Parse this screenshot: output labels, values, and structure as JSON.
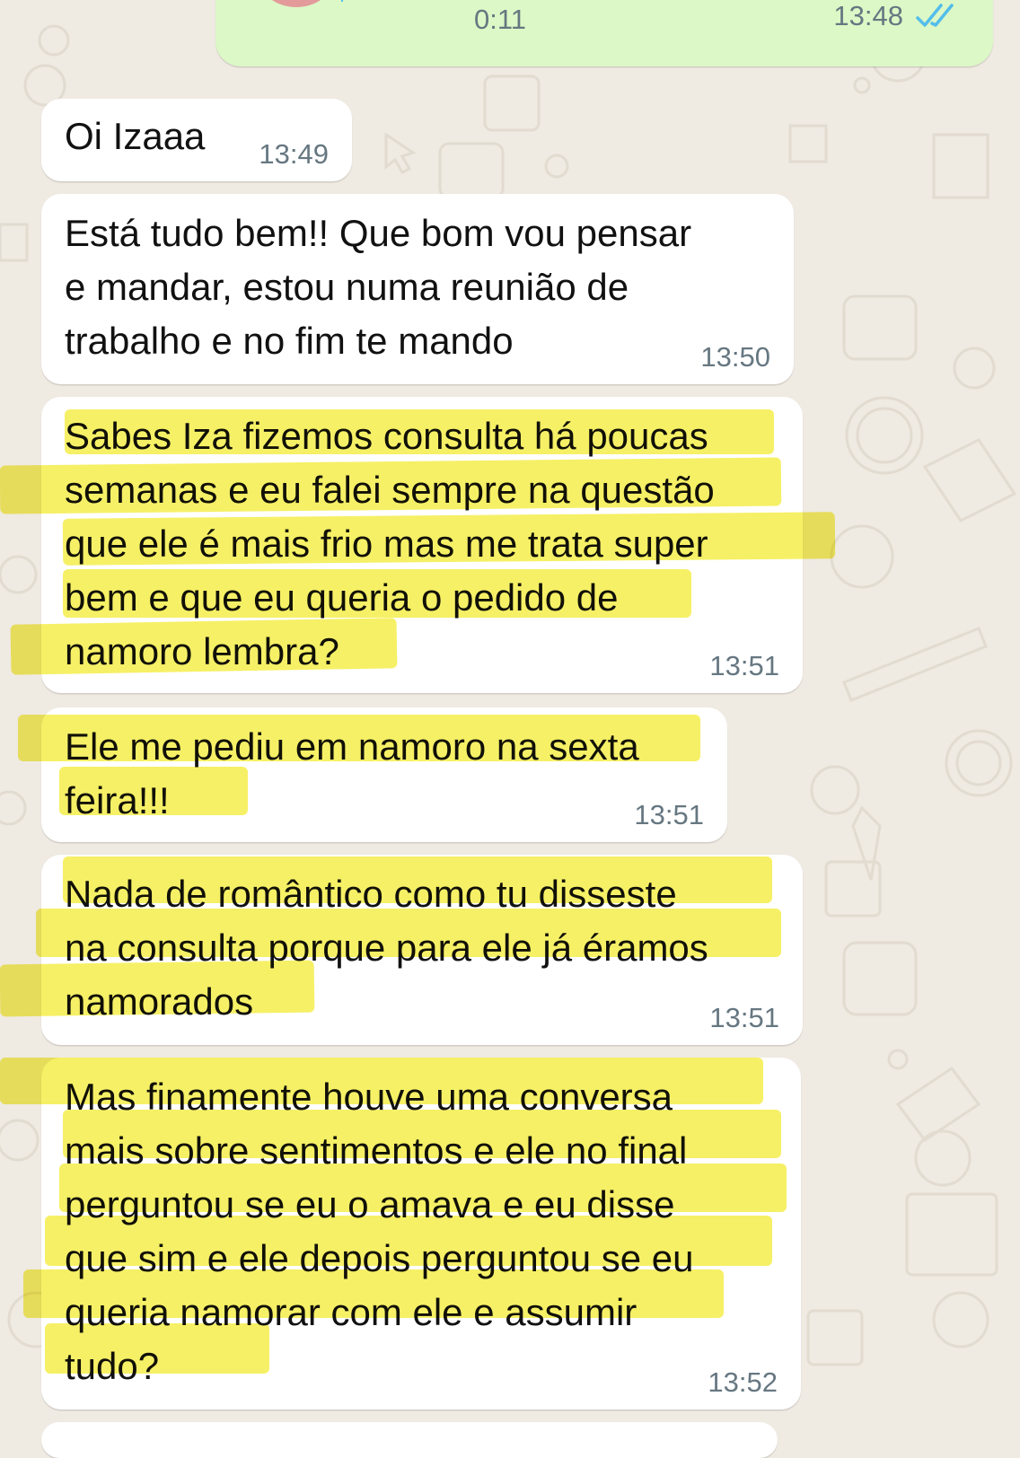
{
  "colors": {
    "chat_background": "#efeae2",
    "incoming_bubble": "#ffffff",
    "outgoing_bubble": "#dcf8c6",
    "timestamp": "#667781",
    "read_ticks": "#53bdeb",
    "highlighter": "#f4ec3a"
  },
  "outgoing_voice": {
    "duration": "0:11",
    "time": "13:48",
    "status_icon": "double-check-read-icon"
  },
  "messages": [
    {
      "text": "Oi Izaaa",
      "time": "13:49",
      "highlighted": false
    },
    {
      "text": "Está tudo bem!! Que bom vou pensar\ne mandar, estou numa reunião de\ntrabalho e no fim te mando",
      "time": "13:50",
      "highlighted": false
    },
    {
      "text": "Sabes Iza fizemos consulta há poucas\nsemanas e eu falei sempre na questão\nque ele é mais frio mas me trata super\nbem e que eu queria o pedido de\nnamoro lembra?",
      "time": "13:51",
      "highlighted": true
    },
    {
      "text": "Ele me pediu em namoro na sexta\nfeira!!!",
      "time": "13:51",
      "highlighted": true
    },
    {
      "text": "Nada de romântico como tu disseste\nna consulta porque para ele já éramos\nnamorados",
      "time": "13:51",
      "highlighted": true
    },
    {
      "text": "Mas finamente houve uma conversa\nmais sobre sentimentos e ele no final\nperguntou se eu o amava e eu disse\nque sim e ele depois perguntou se eu\nqueria namorar com ele e assumir\ntudo?",
      "time": "13:52",
      "highlighted": true
    }
  ]
}
